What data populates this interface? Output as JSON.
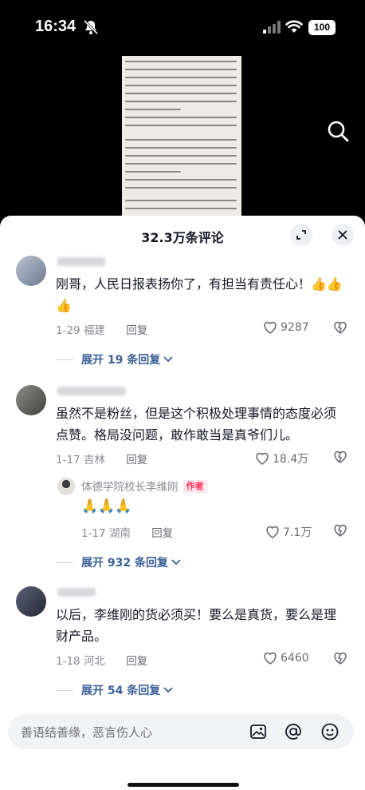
{
  "status_bar": {
    "time": "16:34",
    "battery": "100",
    "icons": [
      "bell-slash-icon",
      "signal-icon",
      "wifi-icon",
      "battery-icon"
    ]
  },
  "video": {
    "search_icon": "search-icon"
  },
  "comments_panel": {
    "title": "32.3万条评论",
    "expand_icon": "expand-icon",
    "close_icon": "close-icon",
    "comments": [
      {
        "text": "刚哥，人民日报表扬你了，有担当有责任心！👍👍👍",
        "date": "1-29",
        "location": "福建",
        "reply_label": "回复",
        "likes": "9287",
        "expand_label": "展开 19 条回复"
      },
      {
        "text": "虽然不是粉丝，但是这个积极处理事情的态度必须点赞。格局没问题，敢作敢当是真爷们儿。",
        "date": "1-17",
        "location": "吉林",
        "reply_label": "回复",
        "likes": "18.4万",
        "reply": {
          "author": "体德学院校长李维刚",
          "author_tag": "作者",
          "text": "🙏🙏🙏",
          "date": "1-17",
          "location": "湖南",
          "reply_label": "回复",
          "likes": "7.1万"
        },
        "expand_label": "展开 932 条回复"
      },
      {
        "text": "以后，李维刚的货必须买！要么是真货，要么是理财产品。",
        "date": "1-18",
        "location": "河北",
        "reply_label": "回复",
        "likes": "6460",
        "expand_label": "展开 54 条回复"
      }
    ]
  },
  "input_bar": {
    "placeholder": "善语结善缘，恶言伤人心",
    "icons": [
      "image-icon",
      "mention-icon",
      "emoji-icon"
    ]
  },
  "colors": {
    "link_blue": "#3a5f96",
    "author_red": "#fe2c55",
    "text": "#161823",
    "meta_gray": "#8a8b91"
  }
}
